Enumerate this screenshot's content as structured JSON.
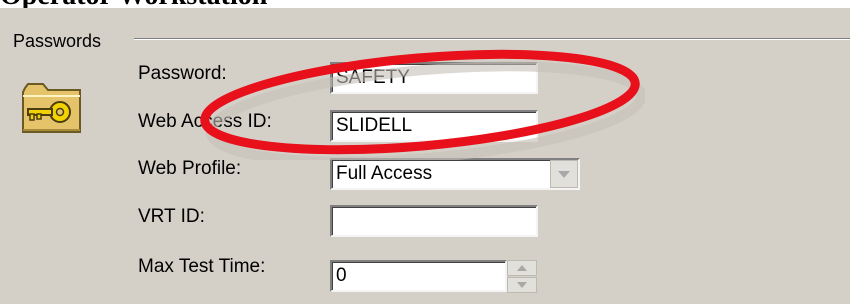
{
  "heading": "Operator Workstation",
  "group": {
    "title": "Passwords"
  },
  "fields": {
    "password": {
      "label": "Password:",
      "value": "SAFETY"
    },
    "web_access_id": {
      "label": "Web Access ID:",
      "value": "SLIDELL"
    },
    "web_profile": {
      "label": "Web Profile:",
      "value": "Full Access"
    },
    "vrt_id": {
      "label": "VRT ID:",
      "value": ""
    },
    "max_test_time": {
      "label": "Max Test Time:",
      "value": "0"
    }
  },
  "icons": {
    "group_icon": "folder-key-icon",
    "dropdown": "chevron-down-icon",
    "spin_up": "triangle-up-icon",
    "spin_down": "triangle-down-icon"
  },
  "colors": {
    "panel": "#d4d0c8",
    "annotation": "#e8101a",
    "folder": "#e4c36a",
    "key": "#f2d200"
  }
}
